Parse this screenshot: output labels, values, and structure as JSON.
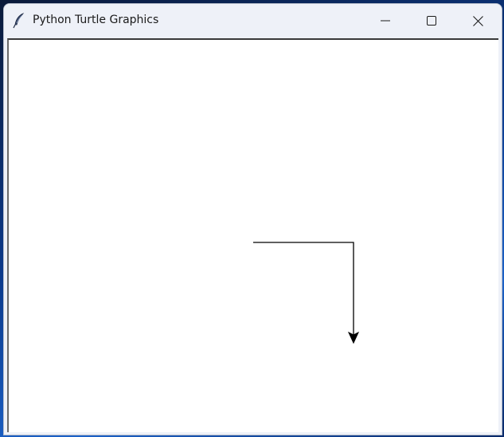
{
  "window": {
    "title": "Python Turtle Graphics",
    "icon": "feather-icon",
    "controls": {
      "minimize": "minimize-icon",
      "maximize": "maximize-icon",
      "close": "close-icon"
    }
  },
  "canvas": {
    "background": "#ffffff",
    "stroke_color": "#000000",
    "turtle_heading": "down"
  },
  "colors": {
    "titlebar": "#eef1f8",
    "desktop_accent": "#1c62c8"
  }
}
